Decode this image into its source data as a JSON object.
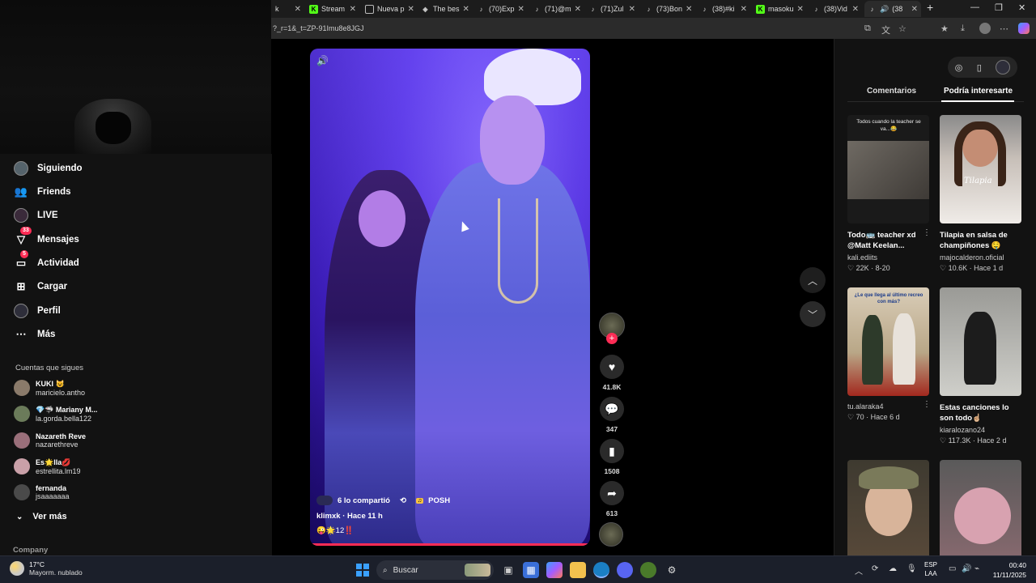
{
  "browser": {
    "tabs": [
      {
        "label": "k",
        "icon": "partial-tab"
      },
      {
        "label": "Stream",
        "icon": "kick-icon"
      },
      {
        "label": "Nueva p",
        "icon": "newtab-icon"
      },
      {
        "label": "The bes",
        "icon": "site-icon"
      },
      {
        "label": "(70)Exp",
        "icon": "tiktok-icon"
      },
      {
        "label": "(71)@m",
        "icon": "tiktok-icon"
      },
      {
        "label": "(71)Zul",
        "icon": "tiktok-icon"
      },
      {
        "label": "(73)Bon",
        "icon": "tiktok-icon"
      },
      {
        "label": "(38)#ki",
        "icon": "tiktok-icon"
      },
      {
        "label": "masoku",
        "icon": "kick-icon"
      },
      {
        "label": "(38)Vid",
        "icon": "tiktok-icon"
      },
      {
        "label": "(38",
        "icon": "tiktok-icon"
      }
    ],
    "url": "?_r=1&_t=ZP-91Imu8e8JGJ"
  },
  "sidebar": {
    "nav": [
      {
        "label": "Siguiendo",
        "icon": "avatar-icon"
      },
      {
        "label": "Friends",
        "icon": "friends-icon"
      },
      {
        "label": "LIVE",
        "icon": "live-icon"
      },
      {
        "label": "Mensajes",
        "icon": "messages-icon",
        "badge": "33"
      },
      {
        "label": "Actividad",
        "icon": "activity-icon",
        "badge": "5"
      },
      {
        "label": "Cargar",
        "icon": "upload-icon"
      },
      {
        "label": "Perfil",
        "icon": "profile-icon"
      },
      {
        "label": "Más",
        "icon": "more-icon"
      }
    ],
    "following_title": "Cuentas que sigues",
    "accounts": [
      {
        "name": "KUKI 😺",
        "handle": "maricielo.antho",
        "color": "#8a7a6a"
      },
      {
        "name": "💎🦈 Mariany M...",
        "handle": "la.gorda.bella122",
        "color": "#6b7b5a"
      },
      {
        "name": "Nazareth Reve",
        "handle": "nazarethreve",
        "color": "#9a6f7a"
      },
      {
        "name": "Es🌟lla💋",
        "handle": "estrellita.lm19",
        "color": "#c9a0a8"
      },
      {
        "name": "fernanda",
        "handle": "jsaaaaaaa",
        "color": "#4a4a4a"
      }
    ],
    "see_more": "Ver más",
    "company": "Company"
  },
  "video": {
    "shared_text": "6 lo compartió",
    "repost_icon": "repost-icon",
    "sound_label": "POSH",
    "author": "klimxk · Hace 11 h",
    "caption": "😜🌟12‼️",
    "progress": 0.99
  },
  "actions": {
    "likes": "41.8K",
    "comments": "347",
    "saves": "1508",
    "shares": "613"
  },
  "right_panel": {
    "tabs": [
      {
        "label": "Comentarios",
        "active": false
      },
      {
        "label": "Podría interesarte",
        "active": true
      }
    ],
    "cards": [
      {
        "thumb_text": "Todos cuando la teacher se va...😂",
        "title": "Todo🚌 teacher xd @Matt Keelan...",
        "user": "kali.ediits",
        "stats": "♡ 22K · 8-20"
      },
      {
        "thumb_text": "Tilapia",
        "title": "Tilapia en salsa de champiñones 🤤",
        "user": "majocalderon.oficial",
        "stats": "♡ 10.6K · Hace 1 d"
      },
      {
        "thumb_text": "¿Le que llega al último recreo con más?",
        "title": "",
        "user": "tu.alaraka4",
        "stats": "♡ 70 · Hace 6 d"
      },
      {
        "thumb_text": "",
        "title": "Estas canciones lo son todo☝🏼",
        "user": "kiaralozano24",
        "stats": "♡ 117.3K · Hace 2 d"
      },
      {
        "thumb_text": "",
        "title": "",
        "user": "",
        "stats": ""
      },
      {
        "thumb_text": "",
        "title": "",
        "user": "",
        "stats": ""
      }
    ]
  },
  "taskbar": {
    "temp": "17°C",
    "weather": "Mayorm. nublado",
    "search_placeholder": "Buscar",
    "lang_top": "ESP",
    "lang_bottom": "LAA",
    "time": "00:40",
    "date": "11/11/2025"
  }
}
